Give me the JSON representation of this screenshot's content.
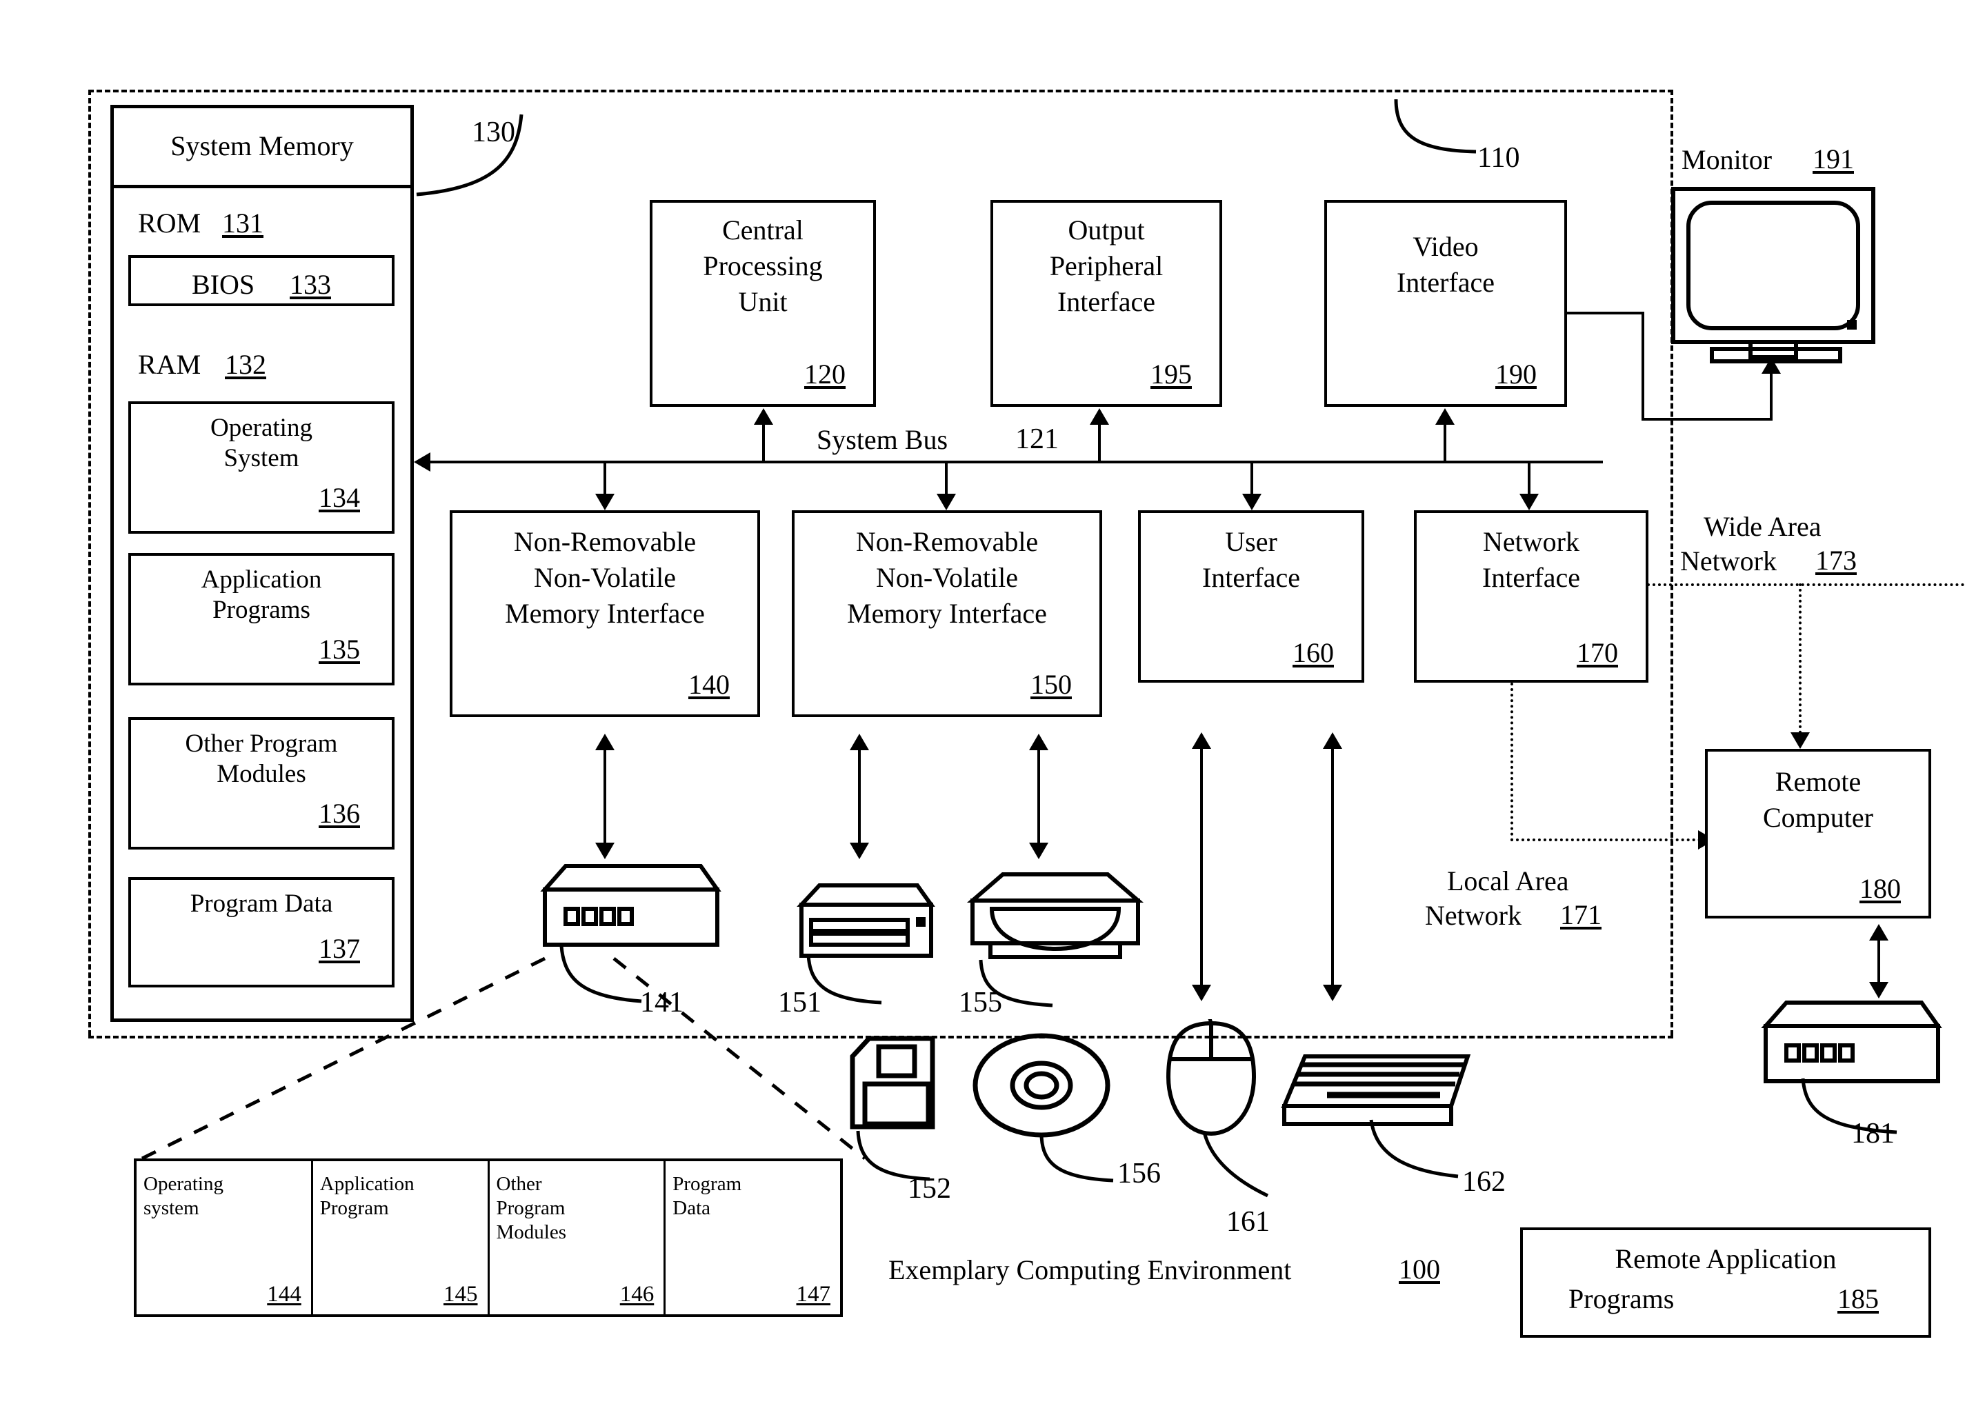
{
  "figure": {
    "caption": "Exemplary Computing Environment",
    "caption_ref": "100",
    "computer_ref": "110"
  },
  "system_memory": {
    "title": "System Memory",
    "ref": "130",
    "rom": {
      "label": "ROM",
      "ref": "131"
    },
    "bios": {
      "label": "BIOS",
      "ref": "133"
    },
    "ram": {
      "label": "RAM",
      "ref": "132"
    },
    "blocks": [
      {
        "line1": "Operating",
        "line2": "System",
        "ref": "134"
      },
      {
        "line1": "Application",
        "line2": "Programs",
        "ref": "135"
      },
      {
        "line1": "Other Program",
        "line2": "Modules",
        "ref": "136"
      },
      {
        "line1": "Program Data",
        "line2": "",
        "ref": "137"
      }
    ]
  },
  "bus": {
    "label": "System Bus",
    "ref": "121"
  },
  "top_boxes": [
    {
      "line1": "Central",
      "line2": "Processing",
      "line3": "Unit",
      "ref": "120"
    },
    {
      "line1": "Output",
      "line2": "Peripheral",
      "line3": "Interface",
      "ref": "195"
    },
    {
      "line1": "Video",
      "line2": "Interface",
      "line3": "",
      "ref": "190"
    }
  ],
  "interface_boxes": [
    {
      "line1": "Non-Removable",
      "line2": "Non-Volatile",
      "line3": "Memory Interface",
      "ref": "140"
    },
    {
      "line1": "Non-Removable",
      "line2": "Non-Volatile",
      "line3": "Memory Interface",
      "ref": "150"
    },
    {
      "line1": "User",
      "line2": "Interface",
      "line3": "",
      "ref": "160"
    },
    {
      "line1": "Network",
      "line2": "Interface",
      "line3": "",
      "ref": "170"
    }
  ],
  "monitor": {
    "label": "Monitor",
    "ref": "191"
  },
  "networks": {
    "wan": {
      "line1": "Wide Area",
      "line2": "Network",
      "ref": "173"
    },
    "lan": {
      "line1": "Local Area",
      "line2": "Network",
      "ref": "171"
    }
  },
  "remote": {
    "computer": {
      "line1": "Remote",
      "line2": "Computer",
      "ref": "180"
    },
    "computer_device_ref": "181",
    "apps": {
      "line1": "Remote Application",
      "line2": "Programs",
      "ref": "185"
    }
  },
  "device_refs": {
    "hard_disk_drive": "141",
    "floppy_drive": "151",
    "floppy_media": "152",
    "optical_drive": "155",
    "optical_media": "156",
    "mouse": "161",
    "keyboard": "162"
  },
  "storage_table": {
    "cells": [
      {
        "line1": "Operating",
        "line2": "system",
        "line3": "",
        "ref": "144"
      },
      {
        "line1": "Application",
        "line2": "Program",
        "line3": "",
        "ref": "145"
      },
      {
        "line1": "Other",
        "line2": "Program",
        "line3": "Modules",
        "ref": "146"
      },
      {
        "line1": "Program",
        "line2": "Data",
        "line3": "",
        "ref": "147"
      }
    ]
  },
  "colors": {
    "ink": "#000000",
    "paper": "#ffffff"
  }
}
